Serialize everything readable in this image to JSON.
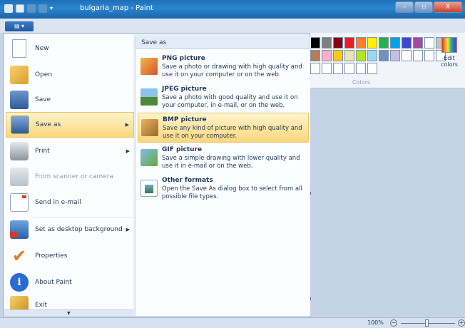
{
  "window": {
    "title": "bulgaria_map - Paint",
    "controls": {
      "minimize": "–",
      "maximize": "▫",
      "close": "X"
    }
  },
  "app_menu_button": "▤ ▾",
  "menu": {
    "items": [
      {
        "label": "New",
        "icon": "new-file-icon",
        "disabled": false,
        "submenu": false
      },
      {
        "label": "Open",
        "icon": "open-folder-icon",
        "disabled": false,
        "submenu": false
      },
      {
        "label": "Save",
        "icon": "save-disk-icon",
        "disabled": false,
        "submenu": false
      },
      {
        "label": "Save as",
        "icon": "save-as-icon",
        "disabled": false,
        "submenu": true,
        "highlighted": true
      },
      {
        "label": "Print",
        "icon": "printer-icon",
        "disabled": false,
        "submenu": true
      },
      {
        "label": "From scanner or camera",
        "icon": "scanner-icon",
        "disabled": true,
        "submenu": false
      },
      {
        "label": "Send in e-mail",
        "icon": "email-icon",
        "disabled": false,
        "submenu": false
      },
      {
        "label": "Set as desktop background",
        "icon": "desktop-icon",
        "disabled": false,
        "submenu": true
      },
      {
        "label": "Properties",
        "icon": "checkmark-icon",
        "disabled": false,
        "submenu": false
      },
      {
        "label": "About Paint",
        "icon": "info-icon",
        "disabled": false,
        "submenu": false
      },
      {
        "label": "Exit",
        "icon": "exit-icon",
        "disabled": false,
        "submenu": false
      }
    ],
    "submenu_arrow": "▶",
    "scroll_arrow": "▼"
  },
  "save_as": {
    "header": "Save as",
    "options": [
      {
        "title": "PNG picture",
        "desc": "Save a photo or drawing with high quality and use it on your computer or on the web.",
        "icon": "png-picture-icon"
      },
      {
        "title": "JPEG picture",
        "desc": "Save a photo with good quality and use it on your computer, in e-mail, or on the web.",
        "icon": "jpeg-picture-icon"
      },
      {
        "title": "BMP picture",
        "desc": "Save any kind of picture with high quality and use it on your computer.",
        "icon": "bmp-picture-icon",
        "highlighted": true
      },
      {
        "title": "GIF picture",
        "desc": "Save a simple drawing with lower quality and use it in e-mail or on the web.",
        "icon": "gif-picture-icon"
      },
      {
        "title": "Other formats",
        "desc": "Open the Save As dialog box to select from all possible file types.",
        "icon": "other-formats-icon"
      }
    ]
  },
  "ribbon": {
    "colors_label": "Colors",
    "edit_colors_label": "Edit colors",
    "palette_rows": [
      [
        "#000000",
        "#7f7f7f",
        "#880015",
        "#ed1c24",
        "#ff7f27",
        "#fff200",
        "#22b14c",
        "#00a2e8",
        "#3f48cc",
        "#a349a4",
        "#ffffff",
        "#ffffff"
      ],
      [
        "#ffffff",
        "#c3c3c3",
        "#b97a57",
        "#ffaec9",
        "#ffc90e",
        "#efe4b0",
        "#b5e61d",
        "#99d9ea",
        "#7092be",
        "#c8bfe7",
        "#ffffff",
        "#ffffff"
      ],
      [
        "#ffffff",
        "#ffffff",
        "#ffffff",
        "#ffffff",
        "#ffffff",
        "#ffffff",
        "#ffffff",
        "#ffffff",
        "#ffffff",
        "#ffffff",
        "#ffffff",
        "#ffffff"
      ]
    ]
  },
  "status": {
    "zoom": "100%",
    "zoom_out": "−",
    "zoom_in": "+"
  }
}
